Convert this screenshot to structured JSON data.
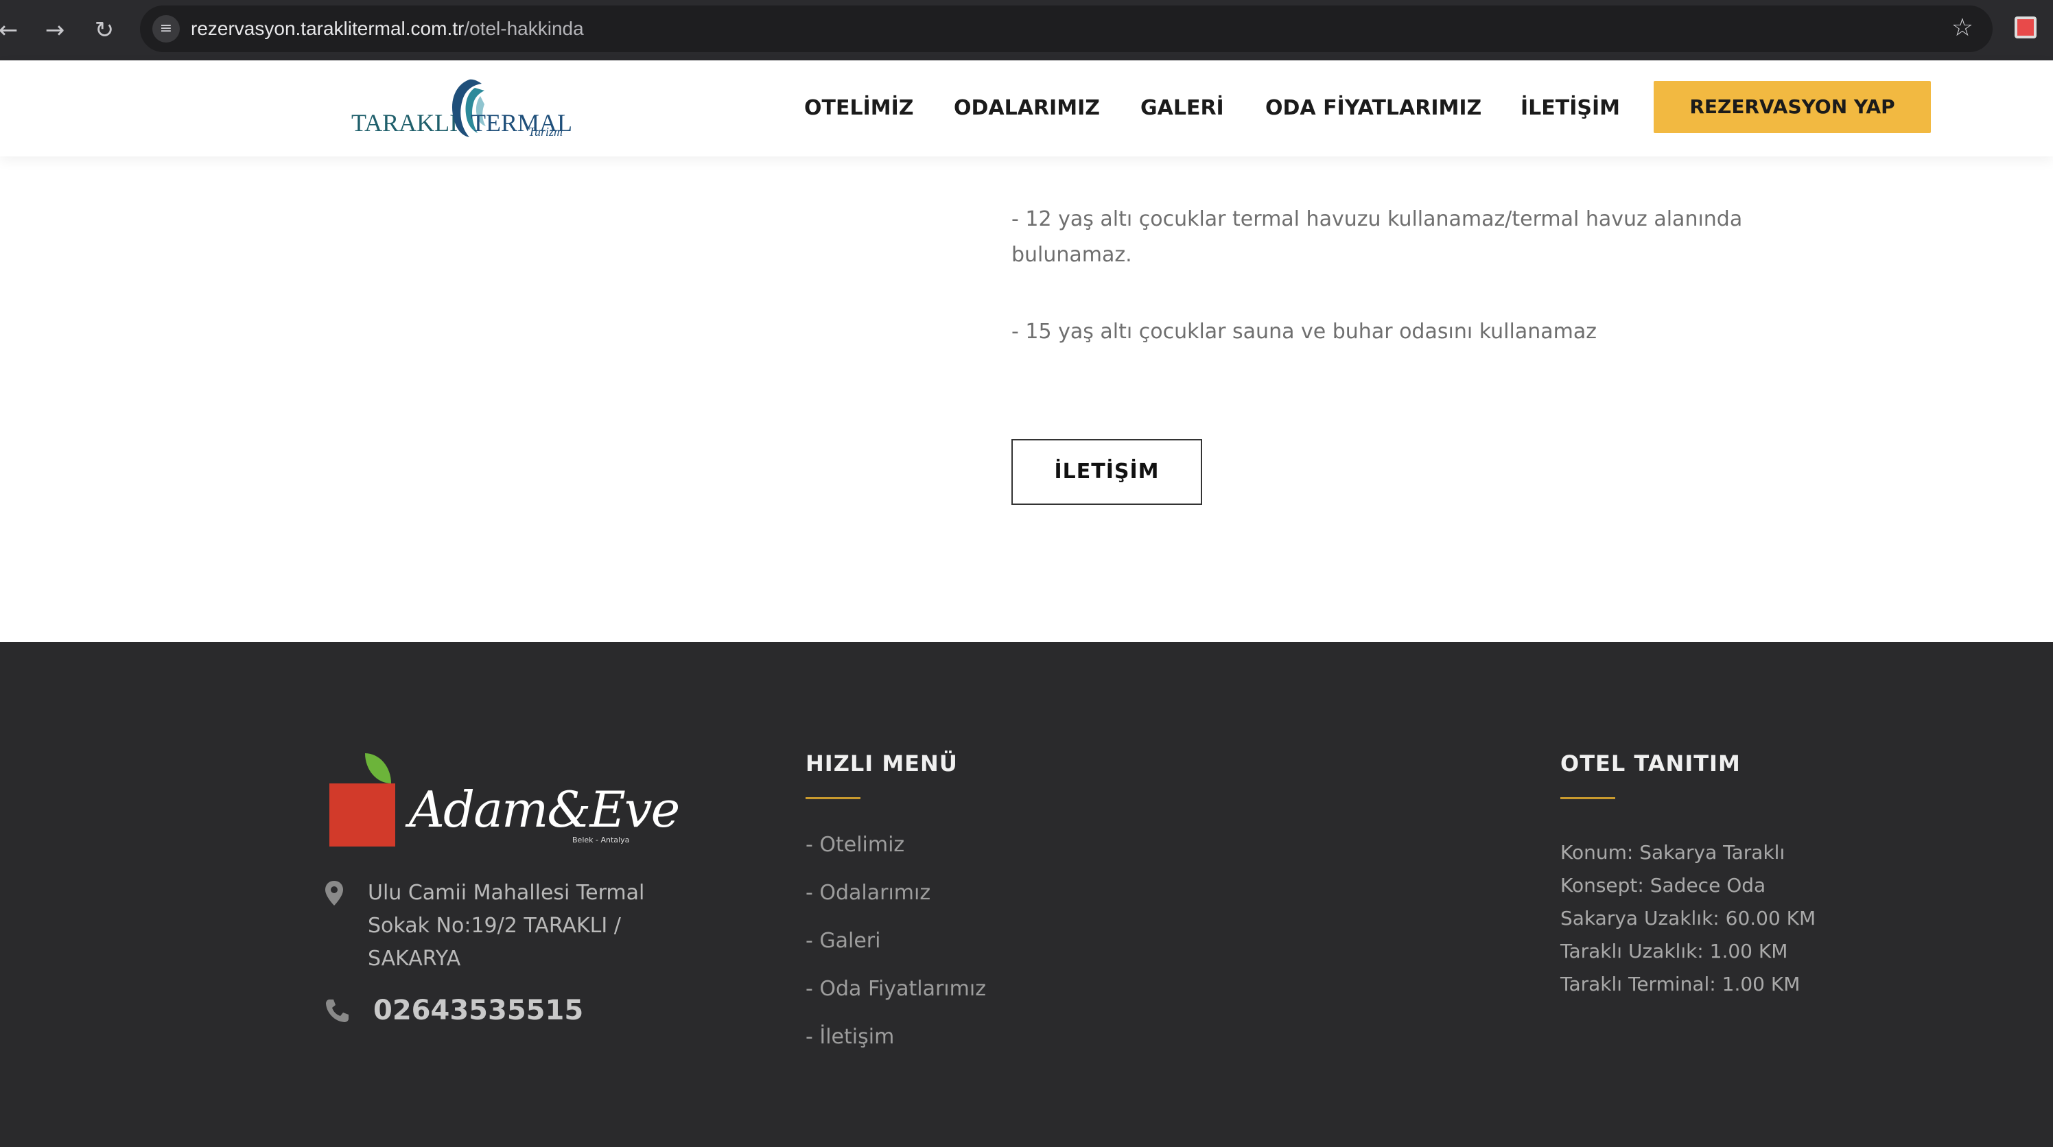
{
  "browser": {
    "back_icon": "arrow-left-icon",
    "forward_icon": "arrow-right-icon",
    "reload_icon": "reload-icon",
    "url_host": "rezervasyon.taraklitermal.com.tr",
    "url_path": "/otel-hakkinda",
    "bookmark_icon": "star-icon"
  },
  "header": {
    "logo_left": "TARAKLI",
    "logo_right": "TERMAL",
    "logo_sub": "Turizm",
    "nav": [
      "OTELİMİZ",
      "ODALARIMIZ",
      "GALERİ",
      "ODA FİYATLARIMIZ",
      "İLETİŞİM"
    ],
    "cta": "REZERVASYON YAP",
    "cta_color": "#f2b941"
  },
  "content": {
    "rule1": "- 12 yaş altı çocuklar termal havuzu kullanamaz/termal havuz alanında bulunamaz.",
    "rule2": "- 15 yaş altı çocuklar sauna ve buhar odasını kullanamaz",
    "contact_button": "İLETİŞİM"
  },
  "footer": {
    "brand": "Adam&Eve",
    "brand_tag": "Belek - Antalya",
    "address": "Ulu Camii Mahallesi Termal Sokak No:19/2 TARAKLI / SAKARYA",
    "phone": "02643535515",
    "quick_menu_title": "HIZLI MENÜ",
    "quick_menu": [
      "- Otelimiz",
      "- Odalarımız",
      "- Galeri",
      "- Oda Fiyatlarımız",
      "- İletişim"
    ],
    "hotel_title": "OTEL TANITIM",
    "hotel_info": [
      "Konum: Sakarya Taraklı",
      "Konsept: Sadece Oda",
      "Sakarya Uzaklık: 60.00 KM",
      "Taraklı Uzaklık: 1.00 KM",
      "Taraklı Terminal: 1.00 KM"
    ],
    "accent_color": "#c99a2e"
  }
}
